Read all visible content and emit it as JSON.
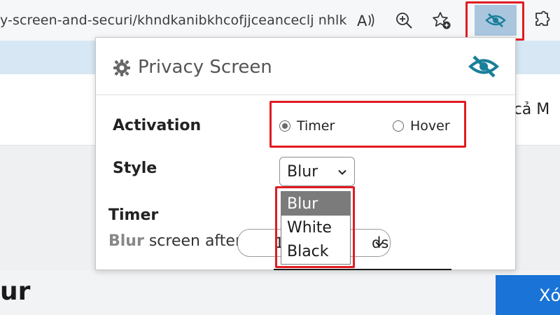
{
  "browser": {
    "url": "y-screen-and-securi/khndkanibkhcofjjceanceclj nhlk...",
    "icons": [
      "read-aloud-icon",
      "zoom-icon",
      "add-favorite-icon",
      "privacy-screen-extension-icon",
      "extensions-icon"
    ]
  },
  "page": {
    "right_text": "t cả M",
    "big_word": "ur",
    "blue_button": "Xó"
  },
  "popup": {
    "title": "Privacy Screen",
    "activation": {
      "label": "Activation",
      "options": [
        {
          "label": "Timer",
          "checked": true
        },
        {
          "label": "Hover",
          "checked": false
        }
      ]
    },
    "style": {
      "label": "Style",
      "value": "Blur",
      "dropdown_options": [
        "Blur",
        "White",
        "Black"
      ],
      "highlighted_option": "Blur"
    },
    "timer": {
      "label": "Timer",
      "prefix_bold": "Blur",
      "prefix_rest": "screen after",
      "value": "1",
      "units_suffix": "ds"
    }
  },
  "colors": {
    "highlight_red": "#e11b22",
    "accent_teal": "#1a7f99",
    "extension_active_bg": "#a9c6de",
    "page_blue_button": "#1a73d6"
  }
}
